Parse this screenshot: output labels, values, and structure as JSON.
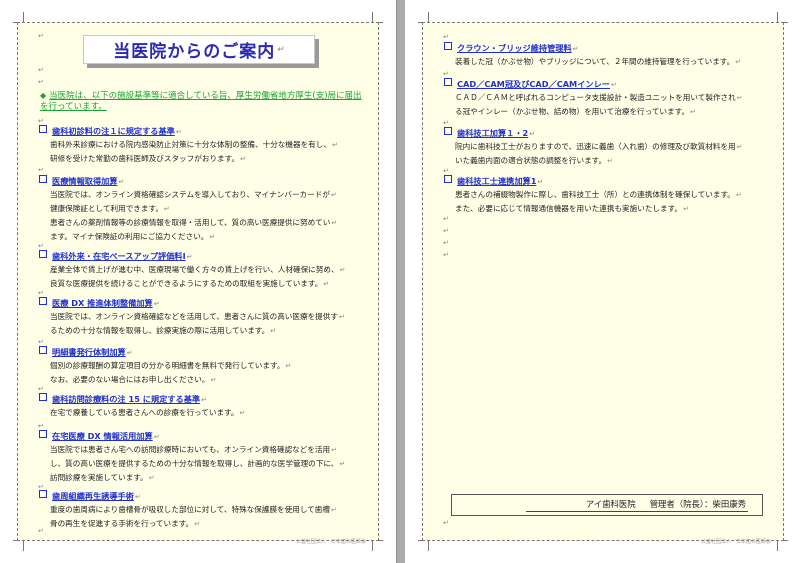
{
  "return_mark": "↵",
  "left_page": {
    "title": "当医院からのご案内",
    "notice": "当医院は、以下の施設基準等に適合している旨、厚生労働省地方厚生(支)局に届出を行っています。",
    "sections": [
      {
        "heading": "歯科初診料の注１に規定する基準",
        "lines": [
          "歯科外来診療における院内感染防止対策に十分な体制の整備、十分な機器を有し、",
          "研修を受けた常勤の歯科医師及びスタッフがおります。"
        ]
      },
      {
        "heading": "医療情報取得加算",
        "lines": [
          "当医院では、オンライン資格確認システムを導入しており、マイナンバーカードが",
          "健康保険証として利用できます。",
          "患者さんの薬剤情報等の診療情報を取得・活用して、質の高い医療提供に努めてい",
          "ます。マイナ保険証の利用にご協力ください。"
        ]
      },
      {
        "heading": "歯科外来・在宅ベースアップ評価料Ⅰ",
        "lines": [
          "産業全体で賃上げが進む中、医療現場で働く方々の賃上げを行い、人材確保に努め、",
          "良質な医療提供を続けることができるようにするための取組を実施しています。"
        ]
      },
      {
        "heading": "医療 DX 推進体制整備加算",
        "lines": [
          "当医院では、オンライン資格確認などを活用して、患者さんに質の高い医療を提供す",
          "るための十分な情報を取得し、診療実施の際に活用しています。"
        ]
      },
      {
        "heading": "明細書発行体制加算",
        "lines": [
          "個別の診療報酬の算定項目の分かる明細書を無料で発行しています。",
          "なお、必要のない場合にはお申し出ください。"
        ]
      },
      {
        "heading": "歯科訪問診療料の注 15 に規定する基準",
        "lines": [
          "在宅で療養している患者さんへの診療を行っています。"
        ]
      },
      {
        "heading": "在宅医療 DX 情報活用加算",
        "lines": [
          "当医院では患者さん宅への訪問診療時においても、オンライン資格確認などを活用",
          "し、質の高い医療を提供するための十分な情報を取得し、計画的な医学管理の下に、",
          "訪問診療を実施しています。"
        ]
      },
      {
        "heading": "歯周組織再生誘導手術",
        "lines": [
          "重度の歯周病により歯槽骨が吸収した部位に対して、特殊な保護膜を使用して歯槽",
          "骨の再生を促進する手術を行っています。"
        ]
      }
    ],
    "footer": "公益社団法人　日本歯科医師会"
  },
  "right_page": {
    "sections": [
      {
        "heading": "クラウン・ブリッジ維持管理料",
        "lines": [
          "装着した冠（かぶせ物）やブリッジについて、２年間の維持管理を行っています。"
        ]
      },
      {
        "heading": "CAD／CAM冠及びCAD／CAMインレー",
        "lines": [
          "ＣＡＤ／ＣＡＭと呼ばれるコンピュータ支援設計・製造ユニットを用いて製作され",
          "る冠やインレー（かぶせ物、詰め物）を用いて治療を行っています。"
        ]
      },
      {
        "heading": "歯科技工加算１・2",
        "lines": [
          "院内に歯科技工士がおりますので、迅速に義歯（入れ歯）の修理及び軟質材料を用",
          "いた義歯内面の適合状態の調整を行います。"
        ]
      },
      {
        "heading": "歯科技工士連携加算1",
        "lines": [
          "患者さんの補綴物製作に際し、歯科技工士（所）との連携体制を確保しています。",
          "また、必要に応じて情報通信機器を用いた連携も実施いたします。"
        ]
      }
    ],
    "clinic_name": "アイ歯科医院",
    "manager": "管理者（院長）：柴田康秀",
    "footer": "公益社団法人　日本歯科医師会"
  }
}
